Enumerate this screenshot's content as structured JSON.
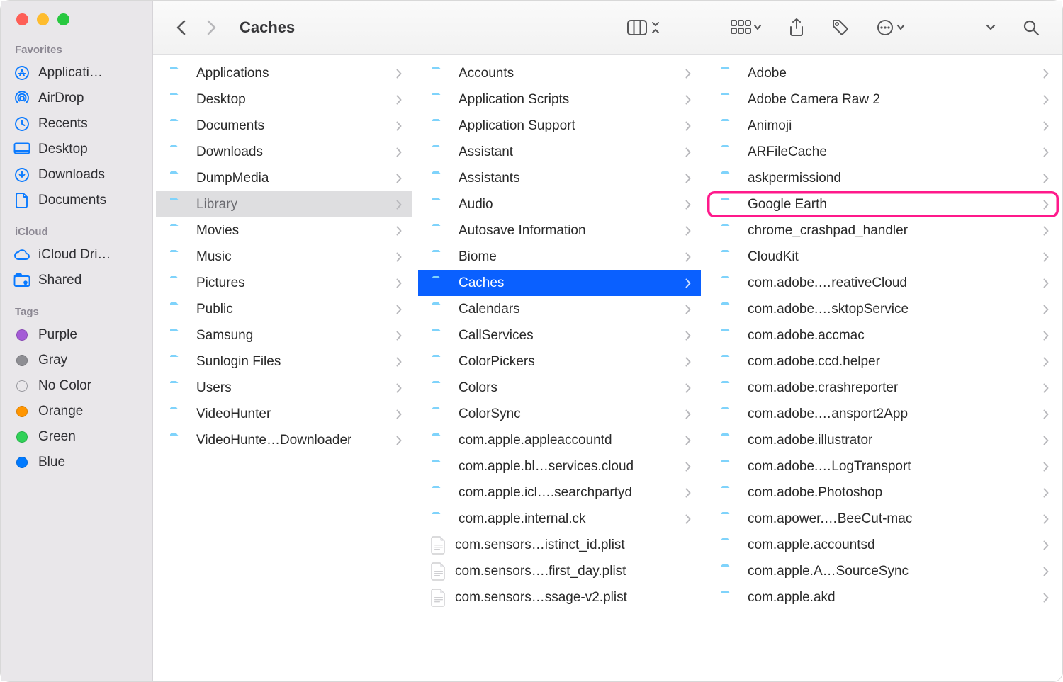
{
  "window_title": "Caches",
  "traffic": [
    "red",
    "yellow",
    "green"
  ],
  "sidebar": {
    "groups": [
      {
        "header": "Favorites",
        "items": [
          {
            "icon": "app-store",
            "label": "Applicati…"
          },
          {
            "icon": "airdrop",
            "label": "AirDrop"
          },
          {
            "icon": "clock",
            "label": "Recents"
          },
          {
            "icon": "desktop",
            "label": "Desktop"
          },
          {
            "icon": "download",
            "label": "Downloads"
          },
          {
            "icon": "document",
            "label": "Documents"
          }
        ]
      },
      {
        "header": "iCloud",
        "items": [
          {
            "icon": "cloud",
            "label": "iCloud Dri…"
          },
          {
            "icon": "shared",
            "label": "Shared"
          }
        ]
      },
      {
        "header": "Tags",
        "items": [
          {
            "icon": "tag",
            "color": "#a45bd6",
            "label": "Purple"
          },
          {
            "icon": "tag",
            "color": "#8e8e93",
            "label": "Gray"
          },
          {
            "icon": "tag",
            "color": "none",
            "label": "No Color"
          },
          {
            "icon": "tag",
            "color": "#ff9500",
            "label": "Orange"
          },
          {
            "icon": "tag",
            "color": "#30d158",
            "label": "Green"
          },
          {
            "icon": "tag",
            "color": "#007aff",
            "label": "Blue"
          }
        ]
      }
    ]
  },
  "columns": [
    {
      "selected_index": 5,
      "selection_style": "ancestor",
      "items": [
        {
          "type": "folder",
          "name": "Applications",
          "expandable": true
        },
        {
          "type": "folder",
          "name": "Desktop",
          "expandable": true
        },
        {
          "type": "folder",
          "name": "Documents",
          "expandable": true
        },
        {
          "type": "folder",
          "name": "Downloads",
          "expandable": true
        },
        {
          "type": "folder",
          "name": "DumpMedia",
          "expandable": true
        },
        {
          "type": "folder",
          "name": "Library",
          "expandable": true
        },
        {
          "type": "folder",
          "name": "Movies",
          "expandable": true
        },
        {
          "type": "folder",
          "name": "Music",
          "expandable": true
        },
        {
          "type": "folder",
          "name": "Pictures",
          "expandable": true
        },
        {
          "type": "folder",
          "name": "Public",
          "expandable": true
        },
        {
          "type": "folder",
          "name": "Samsung",
          "expandable": true
        },
        {
          "type": "folder",
          "name": "Sunlogin Files",
          "expandable": true
        },
        {
          "type": "folder",
          "name": "Users",
          "expandable": true
        },
        {
          "type": "folder",
          "name": "VideoHunter",
          "expandable": true
        },
        {
          "type": "folder",
          "name": "VideoHunte…Downloader",
          "expandable": true
        }
      ]
    },
    {
      "selected_index": 8,
      "selection_style": "selected",
      "items": [
        {
          "type": "folder",
          "name": "Accounts",
          "expandable": true
        },
        {
          "type": "folder",
          "name": "Application Scripts",
          "expandable": true
        },
        {
          "type": "folder",
          "name": "Application Support",
          "expandable": true
        },
        {
          "type": "folder",
          "name": "Assistant",
          "expandable": true
        },
        {
          "type": "folder",
          "name": "Assistants",
          "expandable": true
        },
        {
          "type": "folder",
          "name": "Audio",
          "expandable": true
        },
        {
          "type": "folder",
          "name": "Autosave Information",
          "expandable": true
        },
        {
          "type": "folder",
          "name": "Biome",
          "expandable": true
        },
        {
          "type": "folder",
          "name": "Caches",
          "expandable": true
        },
        {
          "type": "folder",
          "name": "Calendars",
          "expandable": true
        },
        {
          "type": "folder",
          "name": "CallServices",
          "expandable": true
        },
        {
          "type": "folder",
          "name": "ColorPickers",
          "expandable": true
        },
        {
          "type": "folder",
          "name": "Colors",
          "expandable": true
        },
        {
          "type": "folder",
          "name": "ColorSync",
          "expandable": true
        },
        {
          "type": "folder",
          "name": "com.apple.appleaccountd",
          "expandable": true
        },
        {
          "type": "folder",
          "name": "com.apple.bl…services.cloud",
          "expandable": true
        },
        {
          "type": "folder",
          "name": "com.apple.icl….searchpartyd",
          "expandable": true
        },
        {
          "type": "folder",
          "name": "com.apple.internal.ck",
          "expandable": true
        },
        {
          "type": "file",
          "name": "com.sensors…istinct_id.plist",
          "expandable": false
        },
        {
          "type": "file",
          "name": "com.sensors….first_day.plist",
          "expandable": false
        },
        {
          "type": "file",
          "name": "com.sensors…ssage-v2.plist",
          "expandable": false
        }
      ]
    },
    {
      "highlighted_index": 5,
      "items": [
        {
          "type": "folder",
          "name": "Adobe",
          "expandable": true
        },
        {
          "type": "folder",
          "name": "Adobe Camera Raw 2",
          "expandable": true
        },
        {
          "type": "folder",
          "name": "Animoji",
          "expandable": true
        },
        {
          "type": "folder",
          "name": "ARFileCache",
          "expandable": true
        },
        {
          "type": "folder",
          "name": "askpermissiond",
          "expandable": true
        },
        {
          "type": "folder",
          "name": "Google Earth",
          "expandable": true
        },
        {
          "type": "folder",
          "name": "chrome_crashpad_handler",
          "expandable": true
        },
        {
          "type": "folder",
          "name": "CloudKit",
          "expandable": true
        },
        {
          "type": "folder",
          "name": "com.adobe.…reativeCloud",
          "expandable": true
        },
        {
          "type": "folder",
          "name": "com.adobe.…sktopService",
          "expandable": true
        },
        {
          "type": "folder",
          "name": "com.adobe.accmac",
          "expandable": true
        },
        {
          "type": "folder",
          "name": "com.adobe.ccd.helper",
          "expandable": true
        },
        {
          "type": "folder",
          "name": "com.adobe.crashreporter",
          "expandable": true
        },
        {
          "type": "folder",
          "name": "com.adobe.…ansport2App",
          "expandable": true
        },
        {
          "type": "folder",
          "name": "com.adobe.illustrator",
          "expandable": true
        },
        {
          "type": "folder",
          "name": "com.adobe.…LogTransport",
          "expandable": true
        },
        {
          "type": "folder",
          "name": "com.adobe.Photoshop",
          "expandable": true
        },
        {
          "type": "folder",
          "name": "com.apower.…BeeCut-mac",
          "expandable": true
        },
        {
          "type": "folder",
          "name": "com.apple.accountsd",
          "expandable": true
        },
        {
          "type": "folder",
          "name": "com.apple.A…SourceSync",
          "expandable": true
        },
        {
          "type": "folder",
          "name": "com.apple.akd",
          "expandable": true
        }
      ]
    }
  ]
}
